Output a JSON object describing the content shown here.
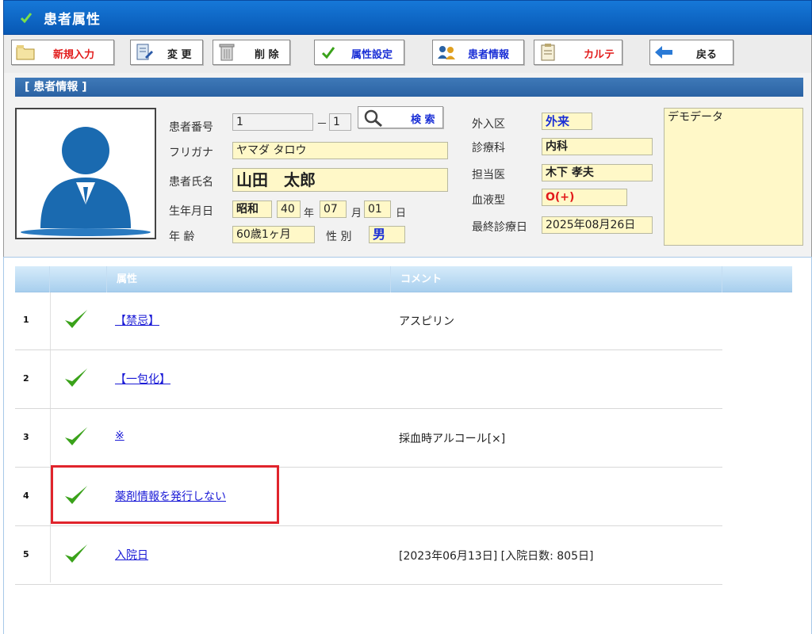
{
  "window": {
    "title": "患者属性"
  },
  "toolbar": {
    "new_label": "新規入力",
    "edit_label": "変 更",
    "delete_label": "削 除",
    "attr_label": "属性設定",
    "patient_label": "患者情報",
    "chart_label": "カルテ",
    "back_label": "戻る"
  },
  "patient": {
    "section_title": "[ 患者情報 ]",
    "id_label": "患者番号",
    "id_value": "1",
    "id_separator": "－",
    "id_branch": "1",
    "search_label": "検 索",
    "kana_label": "フリガナ",
    "kana_value": "ヤマダ タロウ",
    "name_label": "患者氏名",
    "name_value": "山田　太郎",
    "birth_label": "生年月日",
    "birth_era": "昭和",
    "birth_year": "40",
    "birth_year_unit": "年",
    "birth_month": "07",
    "birth_month_unit": "月",
    "birth_day": "01",
    "birth_day_unit": "日",
    "age_label": "年 齢",
    "age_value": "60歳1ヶ月",
    "sex_label": "性 別",
    "sex_value": "男",
    "inout_label": "外入区",
    "inout_value": "外来",
    "dept_label": "診療科",
    "dept_value": "内科",
    "doctor_label": "担当医",
    "doctor_value": "木下 孝夫",
    "blood_label": "血液型",
    "blood_value": "O(+)",
    "last_visit_label": "最終診療日",
    "last_visit_value": "2025年08月26日",
    "memo_value": "デモデータ"
  },
  "list": {
    "headers": {
      "attribute": "属性",
      "comment": "コメント"
    },
    "rows": [
      {
        "no": "1",
        "attribute": "【禁忌】",
        "comment": "アスピリン"
      },
      {
        "no": "2",
        "attribute": "【一包化】",
        "comment": ""
      },
      {
        "no": "3",
        "attribute": "※",
        "comment": "採血時アルコール[×]"
      },
      {
        "no": "4",
        "attribute": "薬剤情報を発行しない",
        "comment": ""
      },
      {
        "no": "5",
        "attribute": "入院日",
        "comment": "[2023年06月13日] [入院日数: 805日]"
      }
    ]
  },
  "colors": {
    "title_bar": "#0a64c8",
    "section_header": "#2f6aaa",
    "field_bg": "#fff8c8",
    "check_green": "#3aa21a",
    "highlight_red": "#e0242c",
    "link_blue": "#1a1ad6"
  },
  "icons": {
    "title": "check-icon",
    "new": "folder-icon",
    "edit": "edit-doc-icon",
    "delete": "trash-icon",
    "attr": "check-icon",
    "patient": "patients-icon",
    "chart": "clipboard-icon",
    "back": "back-arrow-icon",
    "search": "magnifier-icon"
  }
}
